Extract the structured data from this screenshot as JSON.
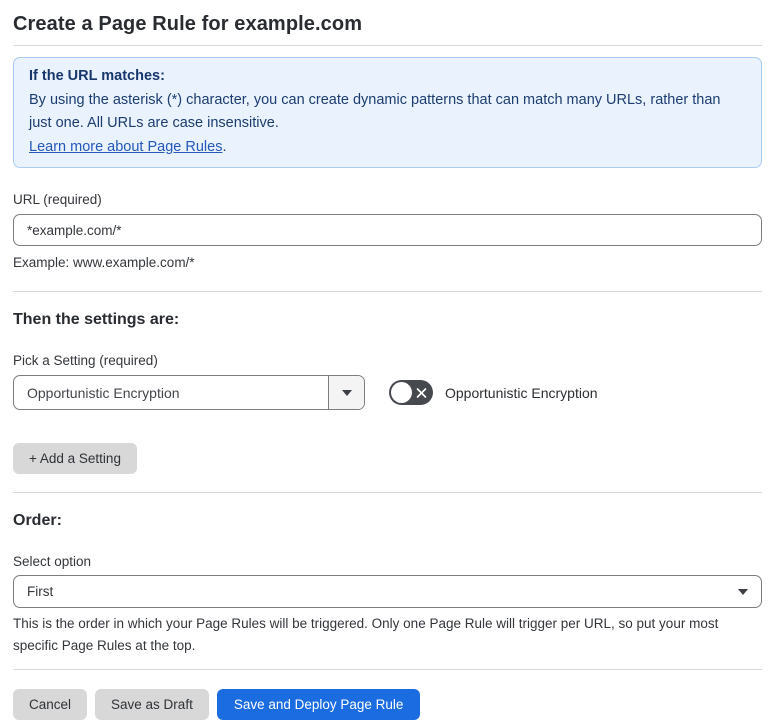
{
  "page": {
    "title": "Create a Page Rule for example.com"
  },
  "info_box": {
    "heading": "If the URL matches:",
    "body": "By using the asterisk (*) character, you can create dynamic patterns that can match many URLs, rather than just one. All URLs are case insensitive.",
    "link": "Learn more about Page Rules",
    "link_suffix": "."
  },
  "url_field": {
    "label": "URL (required)",
    "value": "*example.com/*",
    "helper": "Example: www.example.com/*"
  },
  "settings_section": {
    "heading": "Then the settings are:",
    "picker_label": "Pick a Setting (required)",
    "picker_value": "Opportunistic Encryption",
    "toggle_label": "Opportunistic Encryption",
    "toggle_state": "off",
    "add_setting_button": "+ Add a Setting"
  },
  "order_section": {
    "heading": "Order:",
    "select_label": "Select option",
    "select_value": "First",
    "helper": "This is the order in which your Page Rules will be triggered. Only one Page Rule will trigger per URL, so put your most specific Page Rules at the top."
  },
  "footer": {
    "cancel_label": "Cancel",
    "save_draft_label": "Save as Draft",
    "save_deploy_label": "Save and Deploy Page Rule"
  },
  "colors": {
    "info_bg": "#e9f2fd",
    "info_border": "#a9cdf3",
    "info_text": "#1d3d70",
    "link_blue": "#2458bb",
    "primary_blue": "#1a6ce0",
    "toggle_off_bg": "#46494e",
    "gray_button_bg": "#d8d8d8",
    "input_border": "#7d7d7d",
    "divider": "#d8d8d8"
  }
}
